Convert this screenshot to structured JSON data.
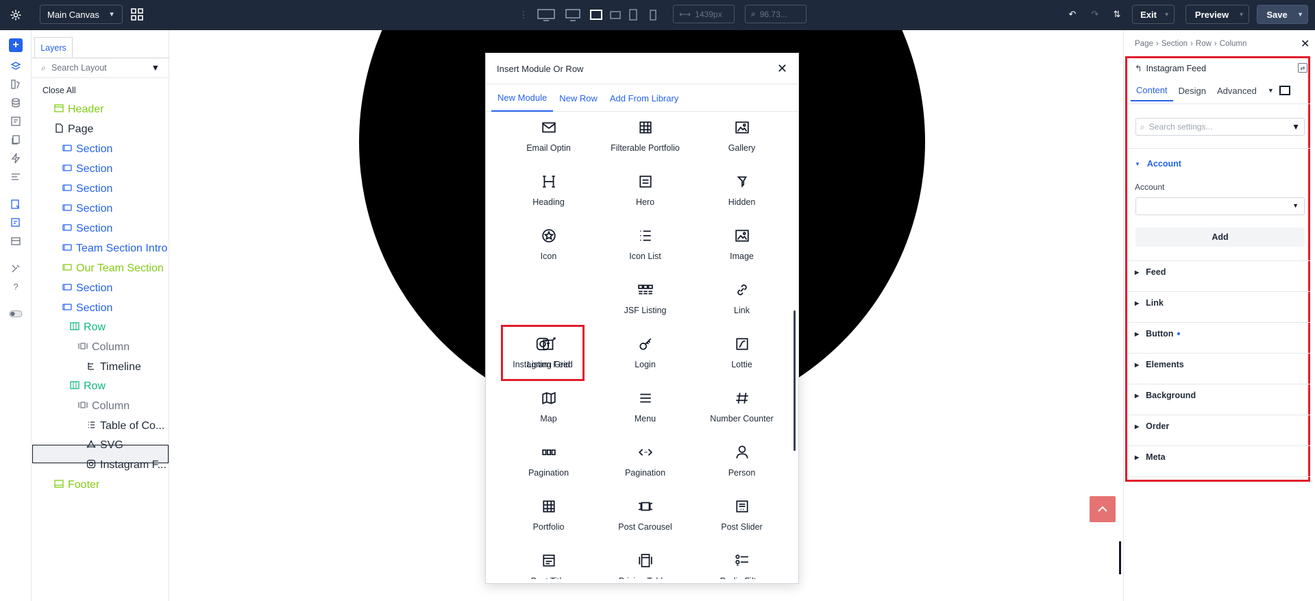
{
  "topbar": {
    "canvas_select": "Main Canvas",
    "width_value": "1439px",
    "zoom_value": "96.73...",
    "exit_label": "Exit",
    "preview_label": "Preview",
    "save_label": "Save"
  },
  "layers": {
    "tab_label": "Layers",
    "search_placeholder": "Search Layout",
    "close_all": "Close All",
    "items": [
      {
        "label": "Header",
        "icon": "header-icon"
      },
      {
        "label": "Page",
        "icon": "page-icon"
      },
      {
        "label": "Section",
        "icon": "section-icon"
      },
      {
        "label": "Section",
        "icon": "section-icon"
      },
      {
        "label": "Section",
        "icon": "section-icon"
      },
      {
        "label": "Section",
        "icon": "section-icon"
      },
      {
        "label": "Section",
        "icon": "section-icon"
      },
      {
        "label": "Team Section Intro",
        "icon": "section-icon"
      },
      {
        "label": "Our Team Section",
        "icon": "section-icon"
      },
      {
        "label": "Section",
        "icon": "section-icon"
      },
      {
        "label": "Section",
        "icon": "section-icon"
      },
      {
        "label": "Row",
        "icon": "row-icon"
      },
      {
        "label": "Column",
        "icon": "column-icon"
      },
      {
        "label": "Timeline",
        "icon": "timeline-icon"
      },
      {
        "label": "Row",
        "icon": "row-icon"
      },
      {
        "label": "Column",
        "icon": "column-icon"
      },
      {
        "label": "Table of Co...",
        "icon": "list-icon"
      },
      {
        "label": "SVG",
        "icon": "svg-icon"
      },
      {
        "label": "Instagram F...",
        "icon": "instagram-icon"
      },
      {
        "label": "Footer",
        "icon": "footer-icon"
      }
    ]
  },
  "modal": {
    "title": "Insert Module Or Row",
    "tabs": [
      "New Module",
      "New Row",
      "Add From Library"
    ],
    "modules": [
      "Email Optin",
      "Filterable Portfolio",
      "Gallery",
      "Heading",
      "Hero",
      "Hidden",
      "Icon",
      "Icon List",
      "Image",
      "Instagram Feed",
      "JSF Listing",
      "Link",
      "Listing Grid",
      "Login",
      "Lottie",
      "Map",
      "Menu",
      "Number Counter",
      "Pagination",
      "Pagination",
      "Person",
      "Portfolio",
      "Post Carousel",
      "Post Slider",
      "Post Title",
      "Pricing Tables",
      "Radio Filter"
    ]
  },
  "settings": {
    "breadcrumb": [
      "Page",
      "Section",
      "Row",
      "Column"
    ],
    "module_title": "Instagram Feed",
    "tabs": [
      "Content",
      "Design",
      "Advanced"
    ],
    "search_placeholder": "Search settings...",
    "account_section": "Account",
    "account_label": "Account",
    "add_label": "Add",
    "sections": [
      "Feed",
      "Link",
      "Button",
      "Elements",
      "Background",
      "Order",
      "Meta"
    ]
  },
  "colors": {
    "accent": "#2563eb",
    "topbar": "#1e293b",
    "highlight": "#e11d2b",
    "green": "#84cc16"
  }
}
